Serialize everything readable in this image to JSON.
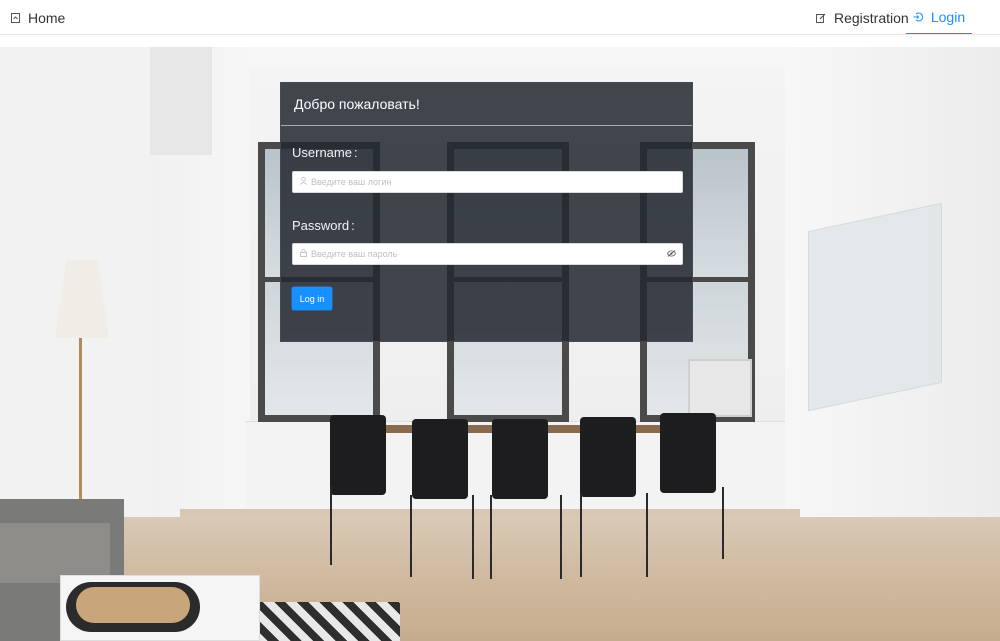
{
  "nav": {
    "home": {
      "label": "Home",
      "icon": "home-icon"
    },
    "registration": {
      "label": "Registration",
      "icon": "edit-form-icon"
    },
    "login": {
      "label": "Login",
      "icon": "login-icon",
      "active": true
    }
  },
  "login_card": {
    "title": "Добро пожаловать!",
    "username_label": "Username",
    "username_placeholder": "Введите ваш логин",
    "password_label": "Password",
    "password_placeholder": "Введите ваш пароль",
    "submit_label": "Log in"
  },
  "colors": {
    "accent": "#1890ff",
    "card_bg": "#232830"
  }
}
